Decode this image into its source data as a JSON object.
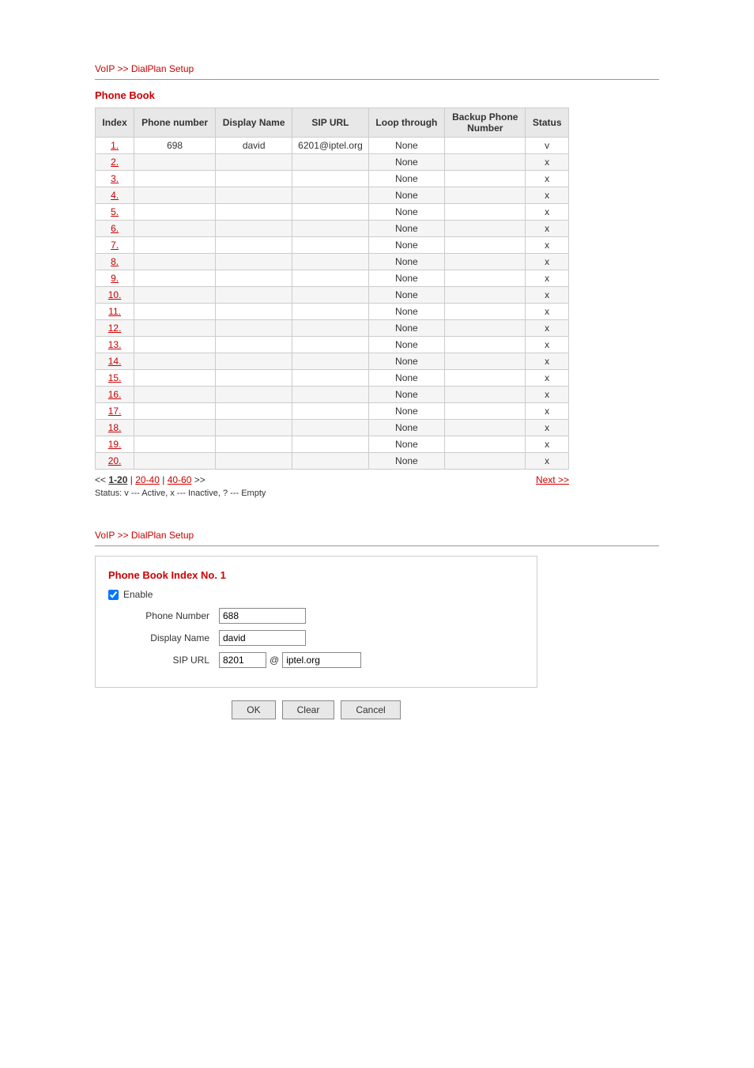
{
  "section1": {
    "breadcrumb": "VoIP >> DialPlan Setup",
    "title": "Phone Book",
    "columns": [
      "Index",
      "Phone number",
      "Display Name",
      "SIP URL",
      "Loop through",
      "Backup Phone Number",
      "Status"
    ],
    "rows": [
      {
        "index": "1.",
        "phone": "698",
        "display": "david",
        "sip": "6201@iptel.org",
        "loop": "None",
        "backup": "",
        "status": "v"
      },
      {
        "index": "2.",
        "phone": "",
        "display": "",
        "sip": "",
        "loop": "None",
        "backup": "",
        "status": "x"
      },
      {
        "index": "3.",
        "phone": "",
        "display": "",
        "sip": "",
        "loop": "None",
        "backup": "",
        "status": "x"
      },
      {
        "index": "4.",
        "phone": "",
        "display": "",
        "sip": "",
        "loop": "None",
        "backup": "",
        "status": "x"
      },
      {
        "index": "5.",
        "phone": "",
        "display": "",
        "sip": "",
        "loop": "None",
        "backup": "",
        "status": "x"
      },
      {
        "index": "6.",
        "phone": "",
        "display": "",
        "sip": "",
        "loop": "None",
        "backup": "",
        "status": "x"
      },
      {
        "index": "7.",
        "phone": "",
        "display": "",
        "sip": "",
        "loop": "None",
        "backup": "",
        "status": "x"
      },
      {
        "index": "8.",
        "phone": "",
        "display": "",
        "sip": "",
        "loop": "None",
        "backup": "",
        "status": "x"
      },
      {
        "index": "9.",
        "phone": "",
        "display": "",
        "sip": "",
        "loop": "None",
        "backup": "",
        "status": "x"
      },
      {
        "index": "10.",
        "phone": "",
        "display": "",
        "sip": "",
        "loop": "None",
        "backup": "",
        "status": "x"
      },
      {
        "index": "11.",
        "phone": "",
        "display": "",
        "sip": "",
        "loop": "None",
        "backup": "",
        "status": "x"
      },
      {
        "index": "12.",
        "phone": "",
        "display": "",
        "sip": "",
        "loop": "None",
        "backup": "",
        "status": "x"
      },
      {
        "index": "13.",
        "phone": "",
        "display": "",
        "sip": "",
        "loop": "None",
        "backup": "",
        "status": "x"
      },
      {
        "index": "14.",
        "phone": "",
        "display": "",
        "sip": "",
        "loop": "None",
        "backup": "",
        "status": "x"
      },
      {
        "index": "15.",
        "phone": "",
        "display": "",
        "sip": "",
        "loop": "None",
        "backup": "",
        "status": "x"
      },
      {
        "index": "16.",
        "phone": "",
        "display": "",
        "sip": "",
        "loop": "None",
        "backup": "",
        "status": "x"
      },
      {
        "index": "17.",
        "phone": "",
        "display": "",
        "sip": "",
        "loop": "None",
        "backup": "",
        "status": "x"
      },
      {
        "index": "18.",
        "phone": "",
        "display": "",
        "sip": "",
        "loop": "None",
        "backup": "",
        "status": "x"
      },
      {
        "index": "19.",
        "phone": "",
        "display": "",
        "sip": "",
        "loop": "None",
        "backup": "",
        "status": "x"
      },
      {
        "index": "20.",
        "phone": "",
        "display": "",
        "sip": "",
        "loop": "None",
        "backup": "",
        "status": "x"
      }
    ],
    "pagination": {
      "prev_label": "<<",
      "pages": [
        {
          "label": "1-20",
          "href": "#",
          "active": true
        },
        {
          "label": "20-40",
          "href": "#",
          "active": false
        },
        {
          "label": "40-60",
          "href": "#",
          "active": false
        }
      ],
      "sep": "|",
      "next_label": ">>",
      "next_link_label": "Next >>"
    },
    "status_legend": "Status: v --- Active, x --- Inactive, ? --- Empty"
  },
  "section2": {
    "breadcrumb": "VoIP >> DialPlan Setup",
    "title": "Phone Book Index No. 1",
    "enable_label": "Enable",
    "fields": {
      "phone_number_label": "Phone Number",
      "phone_number_value": "688",
      "display_name_label": "Display Name",
      "display_name_value": "david",
      "sip_url_label": "SIP URL",
      "sip_url_prefix": "8201",
      "sip_url_at": "@",
      "sip_url_domain": "iptel.org"
    },
    "buttons": {
      "ok": "OK",
      "clear": "Clear",
      "cancel": "Cancel"
    }
  }
}
